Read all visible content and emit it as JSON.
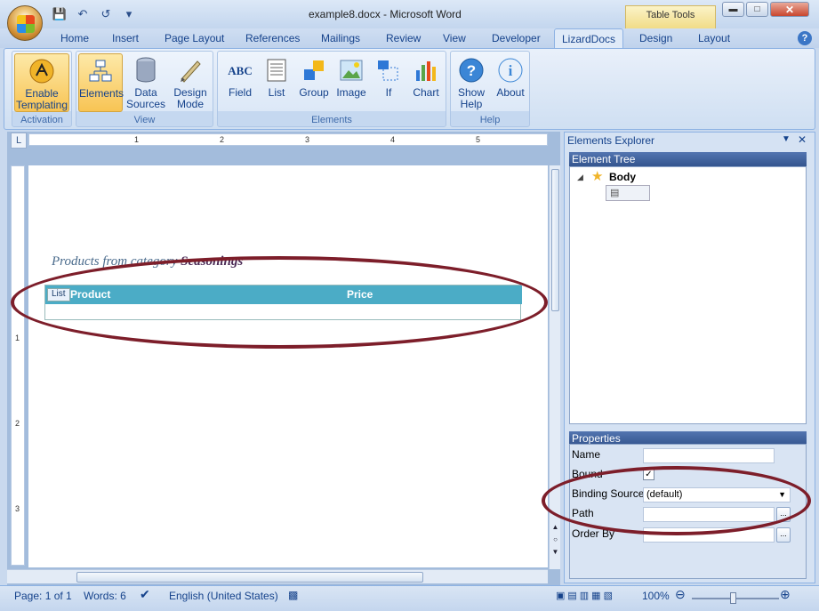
{
  "window": {
    "title": "example8.docx - Microsoft Word",
    "context_tab": "Table Tools"
  },
  "qat": {
    "save_icon": "save-icon",
    "undo_icon": "undo-icon",
    "redo_icon": "redo-icon",
    "customize": "▾"
  },
  "tabs": [
    "Home",
    "Insert",
    "Page Layout",
    "References",
    "Mailings",
    "Review",
    "View",
    "Developer",
    "LizardDocs",
    "Design",
    "Layout"
  ],
  "active_tab": "LizardDocs",
  "ribbon": {
    "activation": {
      "label": "Activation",
      "enable": "Enable Templating"
    },
    "view": {
      "label": "View",
      "elements": "Elements",
      "data_sources": "Data Sources",
      "design_mode": "Design Mode"
    },
    "elements": {
      "label": "Elements",
      "field": "Field",
      "field_icon_text": "ABC",
      "list": "List",
      "group": "Group",
      "image": "Image",
      "if": "If",
      "chart": "Chart"
    },
    "help": {
      "label": "Help",
      "show_help": "Show Help",
      "about": "About"
    }
  },
  "ruler": {
    "box": "L",
    "ticks": [
      "1",
      "2",
      "3",
      "4",
      "5"
    ],
    "vticks": [
      "1",
      "2",
      "3"
    ]
  },
  "document": {
    "heading_prefix": "Products from category",
    "heading_bold": "Seasonings",
    "list_tag": "List",
    "col_product": "Product",
    "col_price": "Price"
  },
  "pane": {
    "title": "Elements Explorer",
    "tree_header": "Element Tree",
    "tree_root": "Body",
    "properties_header": "Properties",
    "props": {
      "name_label": "Name",
      "name_value": "",
      "bound_label": "Bound",
      "bound_checked": "✓",
      "binding_label": "Binding Source",
      "binding_value": "(default)",
      "path_label": "Path",
      "path_value": "",
      "orderby_label": "Order By",
      "orderby_value": "",
      "ellipsis": "..."
    }
  },
  "status": {
    "page": "Page: 1 of 1",
    "words": "Words: 6",
    "language": "English (United States)",
    "zoom": "100%"
  },
  "annotation_color": "#7d1e2a",
  "accent_color": "#4bacc6"
}
